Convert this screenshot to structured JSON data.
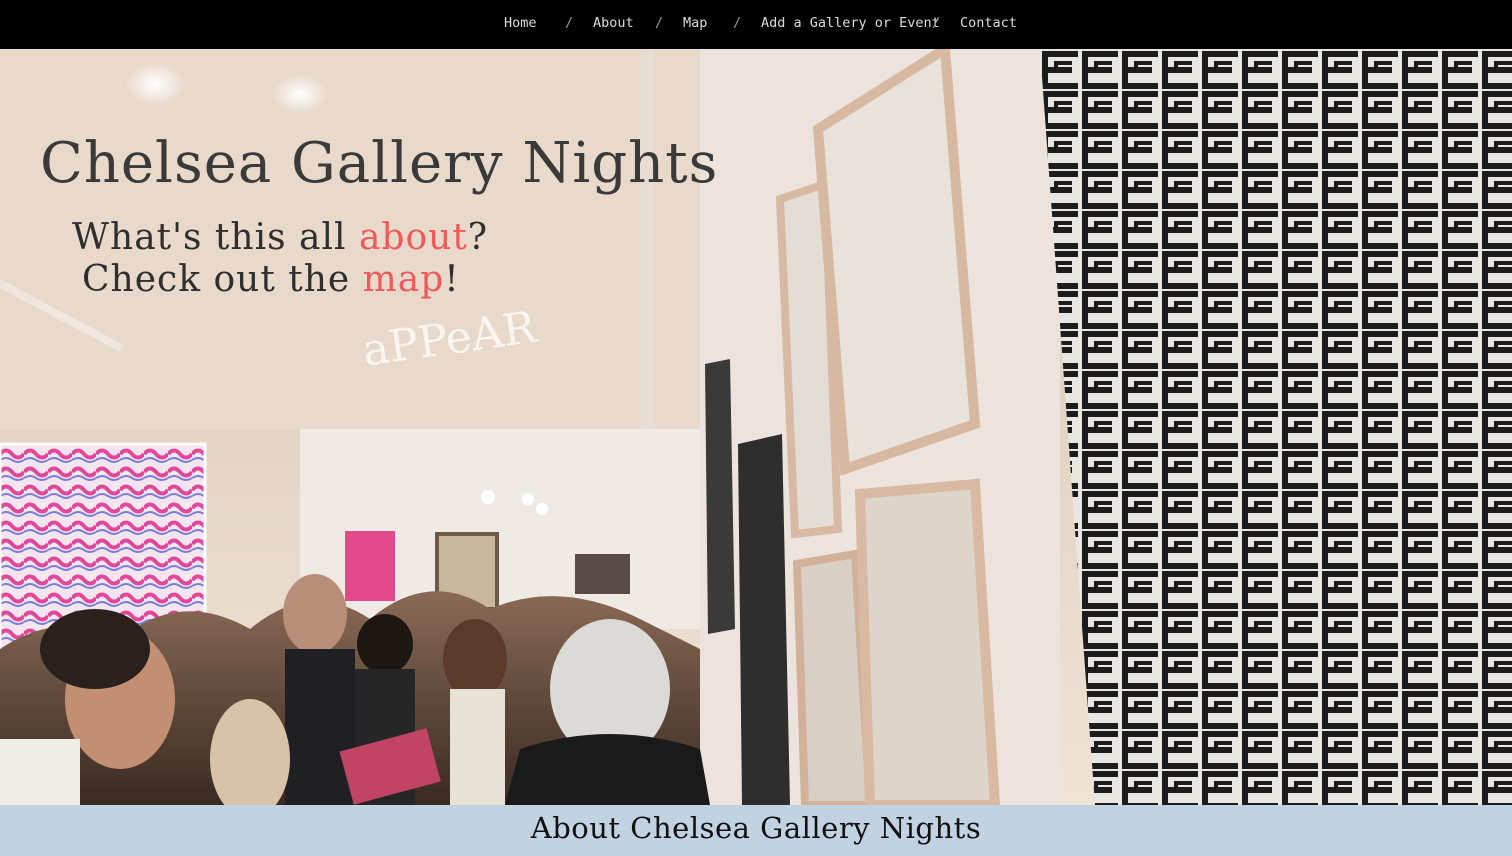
{
  "nav": {
    "items": [
      {
        "label": "Home"
      },
      {
        "label": "About"
      },
      {
        "label": "Map"
      },
      {
        "label": "Add a Gallery or Event"
      },
      {
        "label": "Contact"
      }
    ],
    "separator": "/"
  },
  "hero": {
    "title": "Chelsea Gallery Nights",
    "line1_prefix": "What's this all ",
    "line1_link": "about",
    "line1_suffix": "?",
    "line2_prefix": "Check out the ",
    "line2_link": "map",
    "line2_suffix": "!",
    "accent_color": "#f05a5a",
    "wall_art_text": "aPPeAR"
  },
  "about": {
    "heading": "About Chelsea Gallery Nights",
    "bar_color": "#c1d2e2"
  }
}
